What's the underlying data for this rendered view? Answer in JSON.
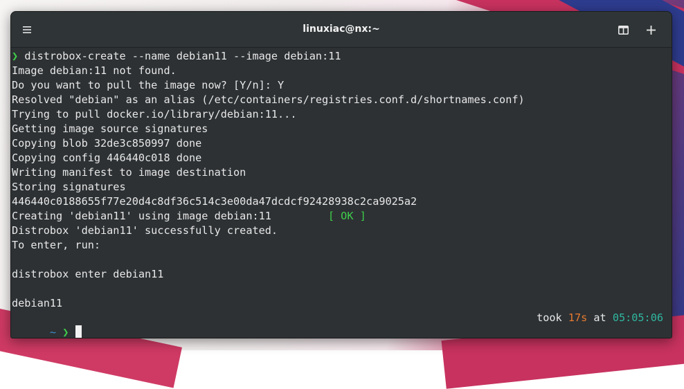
{
  "window": {
    "title": "linuxiac@nx:~"
  },
  "icons": {
    "menu": "hamburger-menu-icon",
    "split": "split-view-icon",
    "new_tab": "plus-icon"
  },
  "terminal": {
    "command_prompt_symbol": "❯",
    "command": "distrobox-create --name debian11 --image debian:11",
    "output": [
      "Image debian:11 not found.",
      "Do you want to pull the image now? [Y/n]: Y",
      "Resolved \"debian\" as an alias (/etc/containers/registries.conf.d/shortnames.conf)",
      "Trying to pull docker.io/library/debian:11...",
      "Getting image source signatures",
      "Copying blob 32de3c850997 done",
      "Copying config 446440c018 done",
      "Writing manifest to image destination",
      "Storing signatures",
      "446440c0188655f77e20d4c8df36c514c3e00da47dcdcf92428938c2ca9025a2"
    ],
    "creating_line": "Creating 'debian11' using image debian:11",
    "ok_status": "[ OK ]",
    "after_output": [
      "Distrobox 'debian11' successfully created.",
      "To enter, run:",
      "",
      "distrobox enter debian11",
      "",
      "debian11"
    ],
    "final_prompt": {
      "dir": "~",
      "symbol": "❯"
    },
    "status": {
      "took_label": "took",
      "duration": "17s",
      "at_label": "at",
      "time": "05:05:06"
    }
  },
  "colors": {
    "prompt_green": "#3fcf4a",
    "dir_blue": "#3e8fd0",
    "duration_orange": "#e87a2f",
    "time_teal": "#2fb8a0",
    "background": "#2d3134"
  }
}
